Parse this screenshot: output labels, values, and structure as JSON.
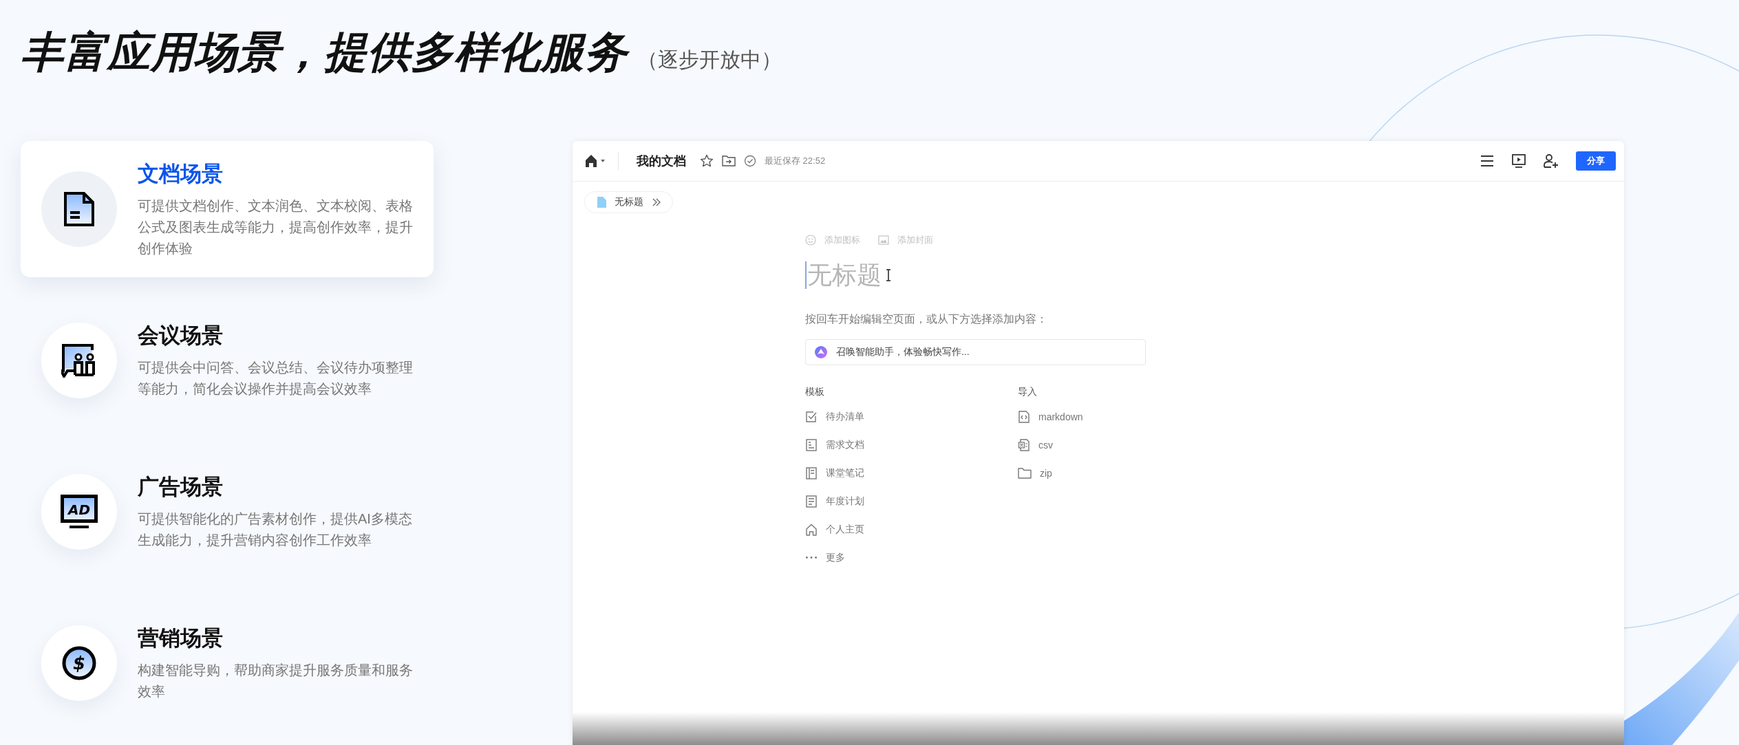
{
  "heading": {
    "title": "丰富应用场景，提供多样化服务",
    "note": "（逐步开放中）"
  },
  "scenes": [
    {
      "kind": "document",
      "title": "文档场景",
      "description": "可提供文档创作、文本润色、文本校阅、表格公式及图表生成等能力，提高创作效率，提升创作体验",
      "selected": true
    },
    {
      "kind": "meeting",
      "title": "会议场景",
      "description": "可提供会中问答、会议总结、会议待办项整理等能力，简化会议操作并提高会议效率",
      "selected": false
    },
    {
      "kind": "ad",
      "icon_text": "AD",
      "title": "广告场景",
      "description": "可提供智能化的广告素材创作，提供AI多模态生成能力，提升营销内容创作工作效率",
      "selected": false
    },
    {
      "kind": "money",
      "icon_text": "$",
      "title": "营销场景",
      "description": "构建智能导购，帮助商家提升服务质量和服务效率",
      "selected": false
    }
  ],
  "editor": {
    "doc_title": "我的文档",
    "save_status": "最近保存 22:52",
    "share_button": "分享",
    "breadcrumb": "无标题",
    "add_icon": "添加图标",
    "add_cover": "添加封面",
    "title_placeholder": "无标题",
    "hint": "按回车开始编辑空页面，或从下方选择添加内容：",
    "assistant_placeholder": "召唤智能助手，体验畅快写作...",
    "templates": {
      "heading": "模板",
      "items": [
        {
          "kind": "checklist",
          "label": "待办清单"
        },
        {
          "kind": "doc",
          "label": "需求文档"
        },
        {
          "kind": "notebook",
          "label": "课堂笔记"
        },
        {
          "kind": "plan",
          "label": "年度计划"
        },
        {
          "kind": "home",
          "label": "个人主页"
        },
        {
          "kind": "more",
          "label": "更多"
        }
      ]
    },
    "import": {
      "heading": "导入",
      "items": [
        {
          "kind": "code",
          "label": "markdown"
        },
        {
          "kind": "table",
          "label": "csv"
        },
        {
          "kind": "folder",
          "label": "zip"
        }
      ]
    }
  }
}
